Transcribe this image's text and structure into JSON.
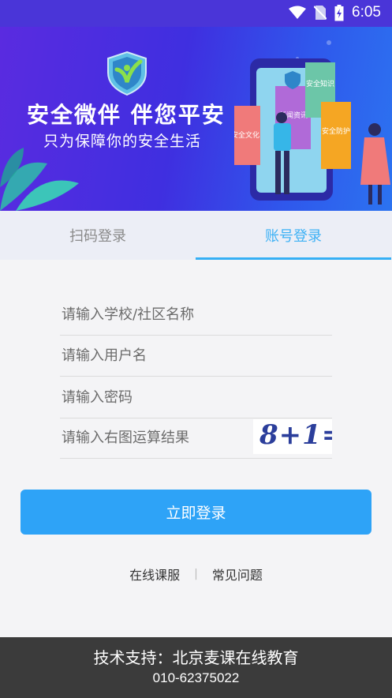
{
  "status_bar": {
    "time": "6:05",
    "icons": [
      "wifi-icon",
      "no-sim-icon",
      "battery-charging-icon"
    ]
  },
  "banner": {
    "title": "安全微伴 伴您平安",
    "subtitle": "只为保障你的安全生活",
    "book_labels": [
      "安全文化",
      "新闻资讯",
      "安全知识",
      "安全防护"
    ]
  },
  "tabs": [
    {
      "label": "扫码登录",
      "active": false
    },
    {
      "label": "账号登录",
      "active": true
    }
  ],
  "form": {
    "school_placeholder": "请输入学校/社区名称",
    "username_placeholder": "请输入用户名",
    "password_placeholder": "请输入密码",
    "captcha_placeholder": "请输入右图运算结果",
    "captcha_text": "8+1="
  },
  "login_button": "立即登录",
  "links": {
    "online_service": "在线课服",
    "separator": "|",
    "faq": "常见问题"
  },
  "footer": {
    "support": "技术支持：北京麦课在线教育",
    "phone": "010-62375022"
  },
  "colors": {
    "accent": "#2ea3f7",
    "active_tab": "#3db1f5",
    "banner_start": "#5a2be0",
    "banner_end": "#2c73f0",
    "footer_bg": "#3b3b3b"
  }
}
